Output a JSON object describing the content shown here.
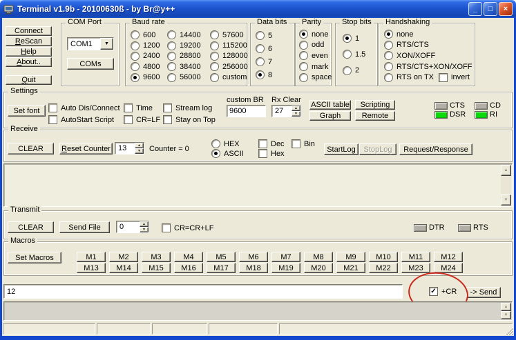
{
  "window": {
    "title": "Terminal v1.9b - 20100630ß - by Br@y++"
  },
  "icons": {
    "minimize": "_",
    "maximize": "□",
    "close": "×",
    "combo_arrow": "▼",
    "spin_up": "▲",
    "spin_down": "▼",
    "scroll_up": "▲",
    "scroll_down": "▼",
    "check": "✓"
  },
  "left_buttons": {
    "connect": "Connect",
    "rescan": "ReScan",
    "help": "Help",
    "about": "About..",
    "quit": "Quit"
  },
  "com_port": {
    "label": "COM Port",
    "selected": "COM1",
    "coms_button": "COMs"
  },
  "baud": {
    "label": "Baud rate",
    "options": [
      "600",
      "1200",
      "2400",
      "4800",
      "9600",
      "14400",
      "19200",
      "28800",
      "38400",
      "56000",
      "57600",
      "115200",
      "128000",
      "256000",
      "custom"
    ],
    "selected": "9600"
  },
  "data_bits": {
    "label": "Data bits",
    "options": [
      "5",
      "6",
      "7",
      "8"
    ],
    "selected": "8"
  },
  "parity": {
    "label": "Parity",
    "options": [
      "none",
      "odd",
      "even",
      "mark",
      "space"
    ],
    "selected": "none"
  },
  "stop_bits": {
    "label": "Stop bits",
    "options": [
      "1",
      "1.5",
      "2"
    ],
    "selected": "1"
  },
  "handshaking": {
    "label": "Handshaking",
    "options": [
      "none",
      "RTS/CTS",
      "XON/XOFF",
      "RTS/CTS+XON/XOFF",
      "RTS on TX"
    ],
    "selected": "none",
    "invert_label": "invert"
  },
  "settings": {
    "label": "Settings",
    "set_font": "Set font",
    "cb_auto_connect": "Auto Dis/Connect",
    "cb_autostart": "AutoStart Script",
    "cb_time": "Time",
    "cb_crlf": "CR=LF",
    "cb_streamlog": "Stream log",
    "cb_stayontop": "Stay on Top",
    "custom_br_label": "custom BR",
    "custom_br_value": "9600",
    "rx_clear_label": "Rx Clear",
    "rx_clear_value": "27",
    "btn_ascii_table": "ASCII table",
    "btn_graph": "Graph",
    "btn_scripting": "Scripting",
    "btn_remote": "Remote",
    "led_cts": "CTS",
    "led_cd": "CD",
    "led_dsr": "DSR",
    "led_ri": "RI"
  },
  "receive": {
    "label": "Receive",
    "clear": "CLEAR",
    "reset_counter": "Reset Counter",
    "spin_value": "13",
    "counter_text": "Counter = 0",
    "radio_hex": "HEX",
    "radio_ascii": "ASCII",
    "cb_dec": "Dec",
    "cb_hex": "Hex",
    "cb_bin": "Bin",
    "startlog": "StartLog",
    "stoplog": "StopLog",
    "request_response": "Request/Response",
    "terminal_content": ""
  },
  "transmit": {
    "label": "Transmit",
    "clear": "CLEAR",
    "send_file": "Send File",
    "spin_value": "0",
    "cb_crcrlf": "CR=CR+LF",
    "led_dtr": "DTR",
    "led_rts": "RTS",
    "terminal_content": ""
  },
  "macros": {
    "label": "Macros",
    "set_macros": "Set Macros",
    "row1": [
      "M1",
      "M2",
      "M3",
      "M4",
      "M5",
      "M6",
      "M7",
      "M8",
      "M9",
      "M10",
      "M11",
      "M12"
    ],
    "row2": [
      "M13",
      "M14",
      "M15",
      "M16",
      "M17",
      "M18",
      "M19",
      "M20",
      "M21",
      "M22",
      "M23",
      "M24"
    ]
  },
  "send": {
    "input_value": "12",
    "cr_label": "+CR",
    "send_button": "-> Send"
  },
  "status_bar": {
    "panels": [
      "",
      "",
      "",
      "",
      ""
    ]
  },
  "colors": {
    "titlebar_blue": "#1C53CC",
    "window_border": "#1247CE",
    "client_bg": "#ECE9D8",
    "rx_area_bg": "#F0EEDF",
    "tx_area_bg": "#D6D3CA",
    "led_on": "#0ADA0A",
    "led_off": "#B3AFA7",
    "annotation_red": "#C8291B"
  }
}
